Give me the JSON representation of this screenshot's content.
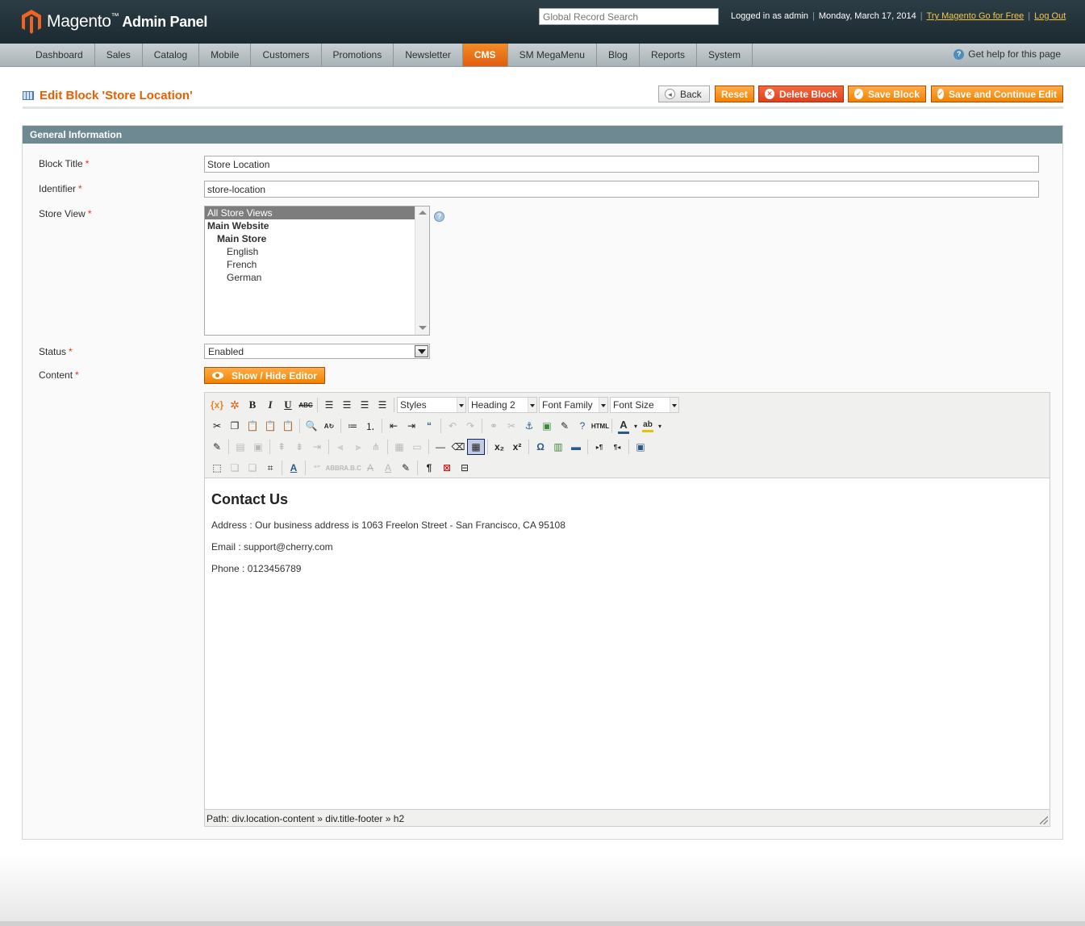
{
  "header": {
    "brand": "Magento",
    "brand_sub": "Admin Panel",
    "search_placeholder": "Global Record Search",
    "logged_in": "Logged in as admin",
    "date": "Monday, March 17, 2014",
    "try_link": "Try Magento Go for Free",
    "logout": "Log Out"
  },
  "nav": {
    "items": [
      "Dashboard",
      "Sales",
      "Catalog",
      "Mobile",
      "Customers",
      "Promotions",
      "Newsletter",
      "CMS",
      "SM MegaMenu",
      "Blog",
      "Reports",
      "System"
    ],
    "active": "CMS",
    "help": "Get help for this page"
  },
  "page": {
    "title": "Edit Block 'Store Location'",
    "buttons": {
      "back": "Back",
      "reset": "Reset",
      "delete": "Delete Block",
      "save": "Save Block",
      "save_continue": "Save and Continue Edit"
    }
  },
  "form": {
    "section_title": "General Information",
    "block_title_label": "Block Title",
    "block_title_value": "Store Location",
    "identifier_label": "Identifier",
    "identifier_value": "store-location",
    "store_view_label": "Store View",
    "store_view_options": [
      "All Store Views",
      "Main Website",
      "Main Store",
      "English",
      "French",
      "German"
    ],
    "status_label": "Status",
    "status_value": "Enabled",
    "content_label": "Content",
    "show_hide_label": "Show / Hide Editor",
    "required_mark": "*"
  },
  "editor": {
    "styles": "Styles",
    "format": "Heading 2",
    "font_family": "Font Family",
    "font_size": "Font Size",
    "content": {
      "heading": "Contact Us",
      "address": "Address : Our business address is 1063 Freelon Street - San Francisco, CA 95108",
      "email": "Email : support@cherry.com",
      "phone": "Phone : 0123456789"
    },
    "path_label": "Path:",
    "path": [
      "div.location-content",
      "div.title-footer",
      "h2"
    ],
    "path_sep": "»"
  },
  "colors": {
    "accent": "#eb5e00",
    "header_bg": "#1b2a31",
    "section_header": "#6f8992"
  }
}
